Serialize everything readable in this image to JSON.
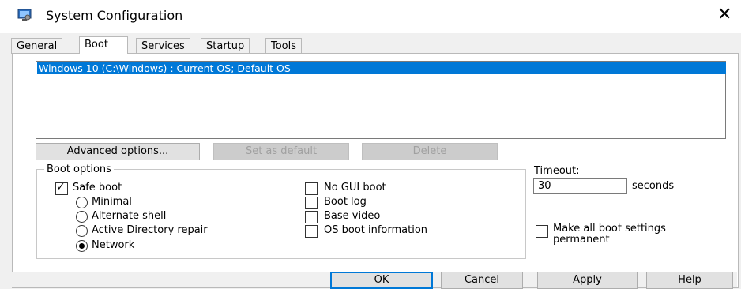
{
  "window": {
    "title": "System Configuration"
  },
  "tabs": [
    {
      "label": "General"
    },
    {
      "label": "Boot",
      "active": true
    },
    {
      "label": "Services"
    },
    {
      "label": "Startup"
    },
    {
      "label": "Tools"
    }
  ],
  "os_list": [
    "Windows 10 (C:\\Windows) : Current OS; Default OS"
  ],
  "os_buttons": {
    "advanced": "Advanced options...",
    "set_default": "Set as default",
    "delete": "Delete"
  },
  "boot_options": {
    "label": "Boot options",
    "safe_boot": {
      "label": "Safe boot",
      "checked": true
    },
    "radios": [
      {
        "label": "Minimal",
        "checked": false
      },
      {
        "label": "Alternate shell",
        "checked": false
      },
      {
        "label": "Active Directory repair",
        "checked": false
      },
      {
        "label": "Network",
        "checked": true
      }
    ],
    "checks": [
      {
        "label": "No GUI boot",
        "checked": false
      },
      {
        "label": "Boot log",
        "checked": false
      },
      {
        "label": "Base video",
        "checked": false
      },
      {
        "label": "OS boot information",
        "checked": false
      }
    ]
  },
  "timeout": {
    "label": "Timeout:",
    "value": "30",
    "unit": "seconds"
  },
  "permanent": {
    "line1": "Make all boot settings",
    "line2": "permanent",
    "checked": false
  },
  "dialog_buttons": {
    "ok": "OK",
    "cancel": "Cancel",
    "apply": "Apply",
    "help": "Help"
  },
  "colors": {
    "selection": "#0078d7",
    "button_face": "#e1e1e1",
    "window_bg": "#f0f0f0"
  }
}
